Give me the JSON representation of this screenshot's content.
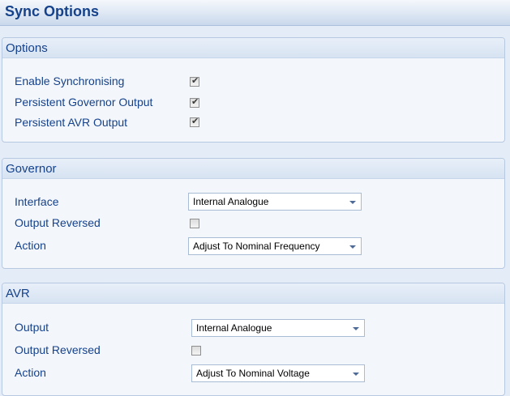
{
  "page": {
    "title": "Sync Options"
  },
  "options": {
    "header": "Options",
    "items": [
      {
        "label": "Enable Synchronising",
        "checked": true
      },
      {
        "label": "Persistent Governor Output",
        "checked": true
      },
      {
        "label": "Persistent AVR Output",
        "checked": true
      }
    ]
  },
  "governor": {
    "header": "Governor",
    "interface_label": "Interface",
    "interface_value": "Internal Analogue",
    "output_reversed_label": "Output Reversed",
    "output_reversed_checked": false,
    "action_label": "Action",
    "action_value": "Adjust To Nominal Frequency"
  },
  "avr": {
    "header": "AVR",
    "output_label": "Output",
    "output_value": "Internal Analogue",
    "output_reversed_label": "Output Reversed",
    "output_reversed_checked": false,
    "action_label": "Action",
    "action_value": "Adjust To Nominal Voltage"
  },
  "icons": {
    "dropdown": "chevron-down-icon",
    "check": "checkmark-icon"
  },
  "colors": {
    "label_text": "#15428b",
    "background": "#e4ecf7",
    "panel_border": "#b7c9e1"
  }
}
